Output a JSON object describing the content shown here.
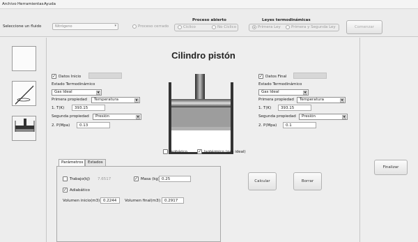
{
  "menu": [
    "Archivo",
    "Herramientas",
    "Ayuda"
  ],
  "toolbar": {
    "fluid_label": "Seleccione un fluido",
    "fluid_value": "Nitrógeno",
    "proceso_cerrado": "Proceso cerrado",
    "proceso_abierto_title": "Proceso abierto",
    "ciclico": "Cíclico",
    "no_ciclico": "No Cíclico",
    "leyes_title": "Leyes termodinámicas",
    "primera_ley": "Primera Ley",
    "primera_segunda_ley": "Primera y Segunda Ley",
    "comenzar": "Comenzar"
  },
  "main": {
    "title": "Cilindro pistón",
    "inicio": {
      "datos_label": "Datos Inicio",
      "estado_label": "Estado Termodinámico",
      "estado_value": "Gas Ideal",
      "primera_label": "Primera propiedad",
      "primera_value": "Temperatura",
      "p1_label": "1. T(K)",
      "p1_value": "393.15",
      "segunda_label": "Segunda propiedad",
      "segunda_value": "Presión",
      "p2_label": "2. P(Mpa)",
      "p2_value": "0.13"
    },
    "final": {
      "datos_label": "Datos Final",
      "estado_label": "Estado Termodinámico",
      "estado_value": "Gas Ideal",
      "primera_label": "Primera propiedad",
      "primera_value": "Temperatura",
      "p1_label": "1. T(K)",
      "p1_value": "393.15",
      "segunda_label": "Segunda propiedad",
      "segunda_value": "Presión",
      "p2_label": "2. P(Mpa)",
      "p2_value": "0.1"
    },
    "isobarico": "Isobárico",
    "isotermico": "Isotérmico (gas ideal)",
    "tabs": [
      "Parámetros",
      "Estados"
    ],
    "trabajo_label": "Trabajo(kJ)",
    "trabajo_value": "7.6517",
    "masa_label": "Masa (kg):",
    "masa_value": "0.25",
    "adiabatico_label": "Adiabático",
    "vol_inicio_label": "Volumen inicio(m3):",
    "vol_inicio_value": "0.2244",
    "vol_final_label": "Volumen final(m3):",
    "vol_final_value": "0.2917",
    "calcular": "Calcular",
    "borrar": "Borrar"
  },
  "right": {
    "finalizar": "Finalizar"
  },
  "check": "✓",
  "colors": {
    "piston_dark": "#3a3a3a",
    "gas_gray": "#9d9d9d"
  }
}
